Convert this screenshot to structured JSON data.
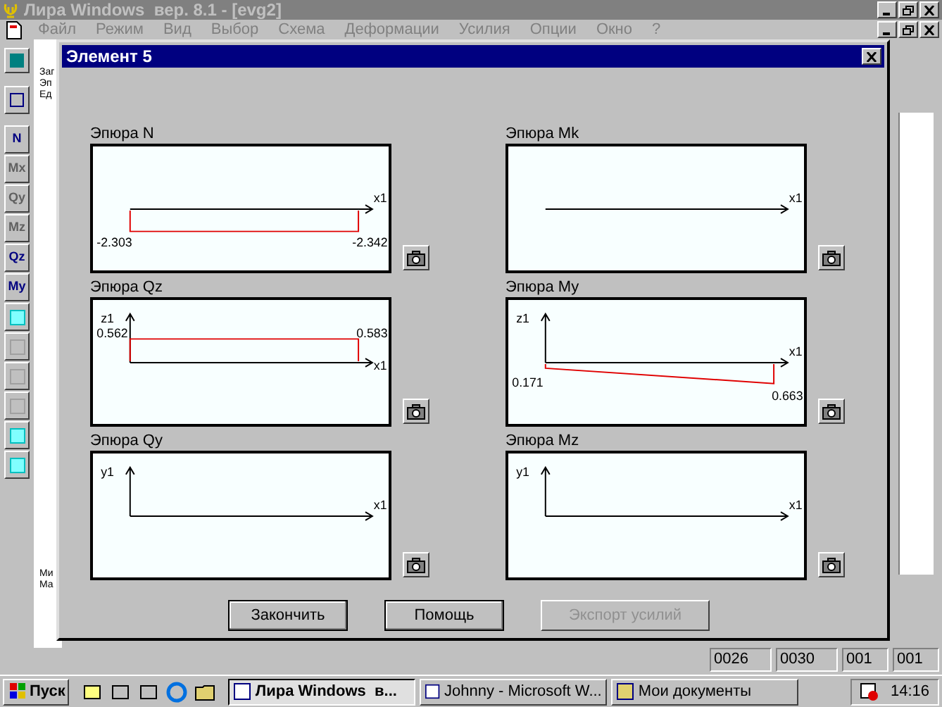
{
  "app": {
    "title": "Лира Windows  вер. 8.1 - [evg2]"
  },
  "menu": [
    "Файл",
    "Режим",
    "Вид",
    "Выбор",
    "Схема",
    "Деформации",
    "Усилия",
    "Опции",
    "Окно",
    "?"
  ],
  "side_buttons": [
    {
      "label": "N",
      "disabled": false
    },
    {
      "label": "Mx",
      "disabled": true
    },
    {
      "label": "Qy",
      "disabled": true
    },
    {
      "label": "Mz",
      "disabled": true
    },
    {
      "label": "Qz",
      "disabled": false
    },
    {
      "label": "My",
      "disabled": false
    }
  ],
  "info_lines": [
    "Заг",
    "Эп",
    "Ед"
  ],
  "info_lines_bottom": [
    "Ми",
    "Ма"
  ],
  "dialog": {
    "title": "Элемент 5",
    "plots": [
      {
        "title": "Эпюра N",
        "kind": "band_below",
        "x_label": "x1",
        "left_value": "-2.303",
        "right_value": "-2.342"
      },
      {
        "title": "Эпюра Mk",
        "kind": "axis",
        "x_label": "x1"
      },
      {
        "title": "Эпюра Qz",
        "kind": "band_above",
        "x_label": "x1",
        "y_label": "z1",
        "left_value": "0.562",
        "right_value": "0.583"
      },
      {
        "title": "Эпюра My",
        "kind": "trapezoid",
        "x_label": "x1",
        "y_label": "z1",
        "left_value": "0.171",
        "right_value": "0.663"
      },
      {
        "title": "Эпюра Qy",
        "kind": "axes",
        "x_label": "x1",
        "y_label": "y1"
      },
      {
        "title": "Эпюра Mz",
        "kind": "axes",
        "x_label": "x1",
        "y_label": "y1"
      }
    ],
    "buttons": [
      {
        "label": "Закончить",
        "disabled": false
      },
      {
        "label": "Помощь",
        "disabled": false
      },
      {
        "label": "Экспорт усилий",
        "disabled": true
      }
    ]
  },
  "status_bar": [
    "0026",
    "0030",
    "001",
    "001"
  ],
  "taskbar": {
    "start": "Пуск",
    "tasks": [
      {
        "label": "Лира Windows  в...",
        "selected": true
      },
      {
        "label": "Johnny - Microsoft W...",
        "selected": false
      },
      {
        "label": "Мои документы",
        "selected": false
      }
    ],
    "clock": "14:16"
  }
}
